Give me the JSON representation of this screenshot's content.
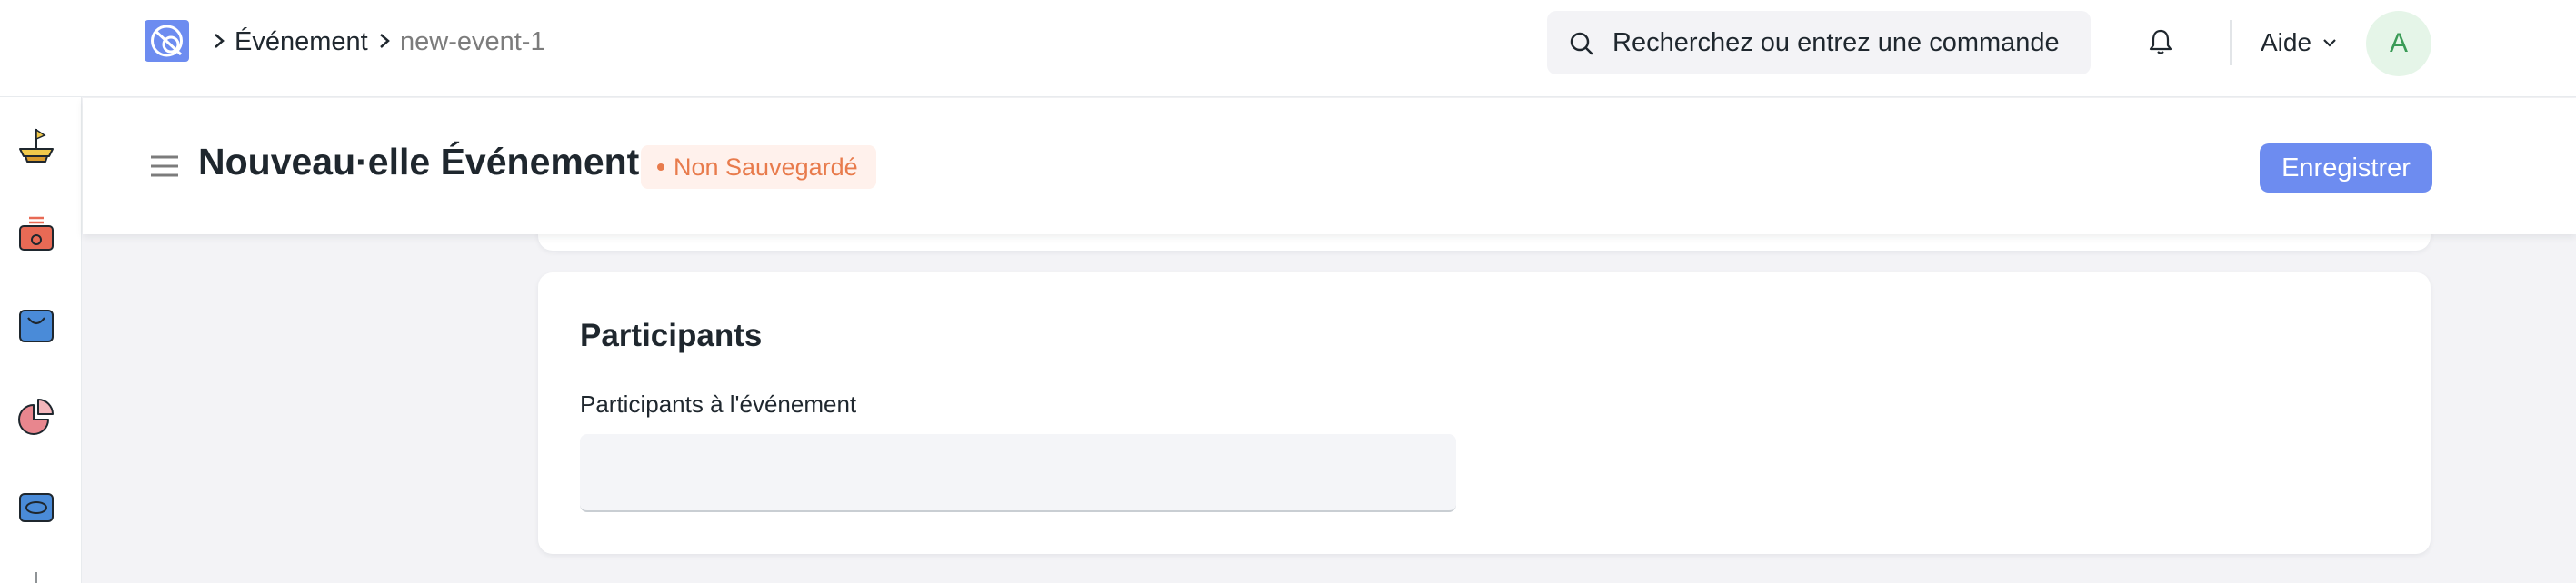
{
  "navbar": {
    "breadcrumbs": [
      "Événement",
      "new-event-1"
    ],
    "search": {
      "placeholder": "Recherchez ou entrez une commande",
      "value": ""
    },
    "help_label": "Aide",
    "avatar_initial": "A"
  },
  "sidebar": {
    "icons": [
      "boat-icon",
      "cash-register-icon",
      "shopping-bag-icon",
      "pie-chart-icon",
      "wallet-icon"
    ]
  },
  "page": {
    "title": "Nouveau·elle Événement",
    "status": "Non Sauvegardé",
    "save_label": "Enregistrer"
  },
  "section": {
    "title": "Participants",
    "field_label": "Participants à l'événement",
    "field_value": ""
  },
  "colors": {
    "primary": "#6d8cf0",
    "status_orange": "#e87b4c",
    "status_bg": "#fff1ec",
    "avatar_bg": "#e5f5e8",
    "avatar_fg": "#3a9b56",
    "page_bg": "#f3f3f6"
  }
}
